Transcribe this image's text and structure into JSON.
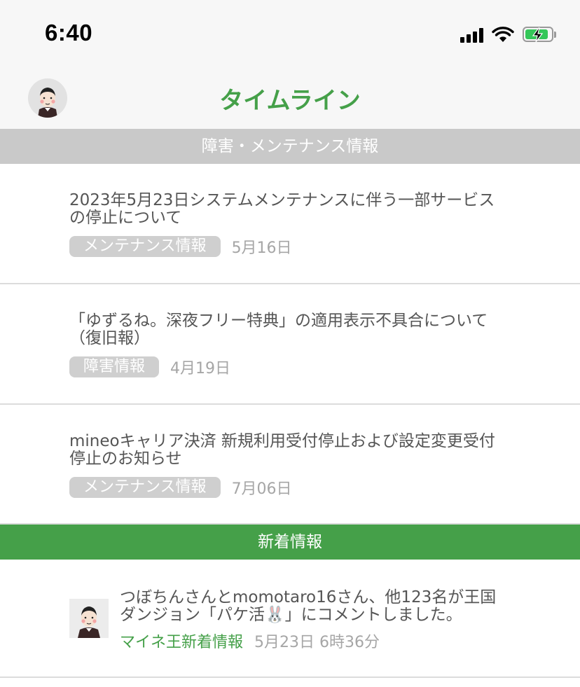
{
  "status_bar": {
    "time": "6:40"
  },
  "header": {
    "title": "タイムライン"
  },
  "sections": {
    "maintenance_title": "障害・メンテナンス情報",
    "news_title": "新着情報"
  },
  "maintenance_items": [
    {
      "title": "2023年5月23日システムメンテナンスに伴う一部サービスの停止について",
      "tag": "メンテナンス情報",
      "date": "5月16日"
    },
    {
      "title": "「ゆずるね。深夜フリー特典」の適用表示不具合について（復旧報）",
      "tag": "障害情報",
      "date": "4月19日"
    },
    {
      "title": "mineoキャリア決済 新規利用受付停止および設定変更受付停止のお知らせ",
      "tag": "メンテナンス情報",
      "date": "7月06日"
    }
  ],
  "news_items": [
    {
      "title": "つぼちんさんとmomotaro16さん、他123名が王国ダンジョン「パケ活🐰」にコメントしました。",
      "tag": "マイネ王新着情報",
      "date": "5月23日 6時36分"
    }
  ],
  "colors": {
    "accent": "#45a049",
    "section_gray": "#c9c9c9",
    "tag_gray": "#cfcfcf"
  },
  "icons": [
    "cellular-signal-icon",
    "wifi-icon",
    "battery-charging-icon",
    "profile-avatar-icon"
  ]
}
